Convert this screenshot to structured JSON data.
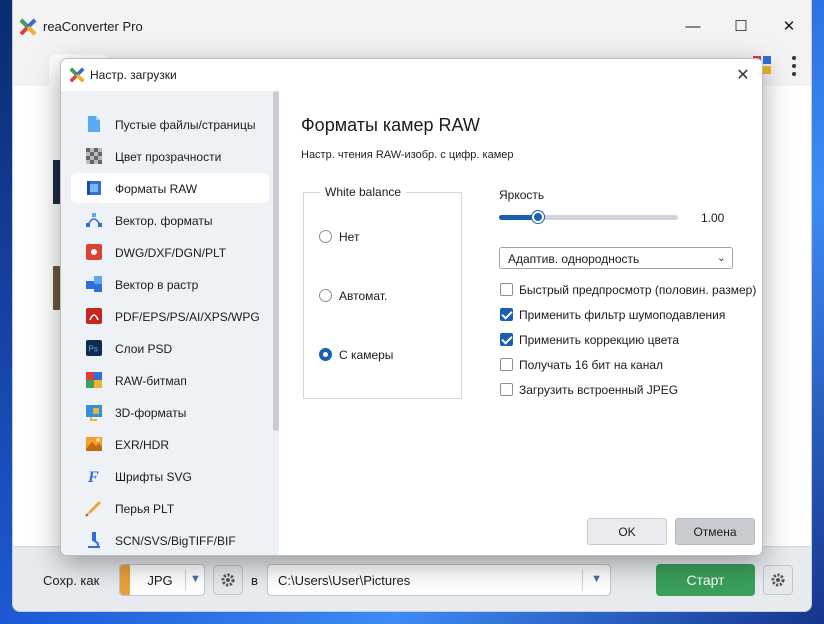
{
  "app": {
    "title": "reaConverter Pro"
  },
  "window_controls": {
    "minimize": "—",
    "maximize": "☐",
    "close": "✕"
  },
  "bottombar": {
    "save_as_label": "Сохр. как",
    "format_value": "JPG",
    "in_label": "в",
    "path_value": "C:\\Users\\User\\Pictures",
    "start_label": "Старт"
  },
  "dialog": {
    "title": "Настр. загрузки",
    "close": "✕",
    "sidebar": [
      {
        "label": "Пустые файлы/страницы",
        "icon": "blank-file-icon"
      },
      {
        "label": "Цвет прозрачности",
        "icon": "transparency-icon"
      },
      {
        "label": "Форматы RAW",
        "icon": "raw-camera-icon",
        "active": true
      },
      {
        "label": "Вектор. форматы",
        "icon": "vector-icon"
      },
      {
        "label": "DWG/DXF/DGN/PLT",
        "icon": "cad-icon"
      },
      {
        "label": "Вектор в растр",
        "icon": "vector-to-raster-icon"
      },
      {
        "label": "PDF/EPS/PS/AI/XPS/WPG",
        "icon": "pdf-icon"
      },
      {
        "label": "Слои PSD",
        "icon": "psd-icon"
      },
      {
        "label": "RAW-битмап",
        "icon": "raw-bitmap-icon"
      },
      {
        "label": "3D-форматы",
        "icon": "3d-icon"
      },
      {
        "label": "EXR/HDR",
        "icon": "hdr-icon"
      },
      {
        "label": "Шрифты SVG",
        "icon": "font-icon"
      },
      {
        "label": "Перья PLT",
        "icon": "pen-icon"
      },
      {
        "label": "SCN/SVS/BigTIFF/BIF",
        "icon": "microscope-icon"
      }
    ],
    "main": {
      "heading": "Форматы камер RAW",
      "subheading": "Настр. чтения RAW-изобр. с цифр. камер",
      "white_balance": {
        "legend": "White balance",
        "options": [
          {
            "label": "Нет",
            "selected": false
          },
          {
            "label": "Автомат.",
            "selected": false
          },
          {
            "label": "С камеры",
            "selected": true
          }
        ]
      },
      "brightness": {
        "label": "Яркость",
        "value_text": "1.00",
        "fraction": 0.22
      },
      "interpolation_select": {
        "value": "Адаптив. однородность"
      },
      "checkboxes": [
        {
          "label": "Быстрый предпросмотр (половин. размер)",
          "checked": false
        },
        {
          "label": "Применить фильтр шумоподавления",
          "checked": true
        },
        {
          "label": "Применить коррекцию цвета",
          "checked": true
        },
        {
          "label": "Получать 16 бит на канал",
          "checked": false
        },
        {
          "label": "Загрузить встроенный JPEG",
          "checked": false
        }
      ],
      "ok_label": "OK",
      "cancel_label": "Отмена"
    }
  },
  "colors": {
    "accent": "#1a5fb4",
    "start": "#3aa05a",
    "format_stripe": "#e9a23b"
  }
}
